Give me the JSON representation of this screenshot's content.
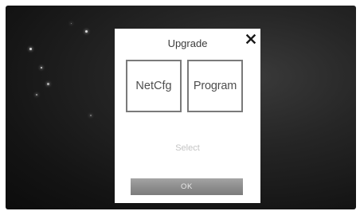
{
  "background": {
    "style": "dark starry sky"
  },
  "dialog": {
    "title": "Upgrade",
    "close_icon": "close-icon",
    "options": [
      {
        "label": "NetCfg"
      },
      {
        "label": "Program"
      }
    ],
    "status_text": "Select",
    "ok_label": "OK"
  },
  "colors": {
    "dialog_background": "#ffffff",
    "option_border": "#7a7a7a",
    "ok_button": "#8e8e8e",
    "status_text": "#c4c4c4"
  }
}
